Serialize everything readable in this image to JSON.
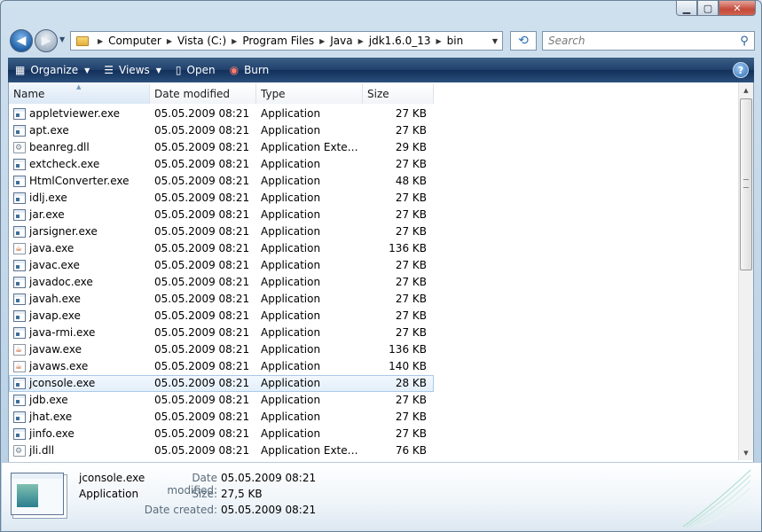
{
  "navigation": {
    "breadcrumbs": [
      "Computer",
      "Vista (C:)",
      "Program Files",
      "Java",
      "jdk1.6.0_13",
      "bin"
    ],
    "search_placeholder": "Search"
  },
  "toolbar": {
    "organize": "Organize",
    "views": "Views",
    "open": "Open",
    "burn": "Burn"
  },
  "columns": {
    "name": "Name",
    "date": "Date modified",
    "type": "Type",
    "size": "Size"
  },
  "files": [
    {
      "name": "appletviewer.exe",
      "date": "05.05.2009 08:21",
      "type": "Application",
      "size": "27 KB",
      "icon": "app"
    },
    {
      "name": "apt.exe",
      "date": "05.05.2009 08:21",
      "type": "Application",
      "size": "27 KB",
      "icon": "app"
    },
    {
      "name": "beanreg.dll",
      "date": "05.05.2009 08:21",
      "type": "Application Extens...",
      "size": "29 KB",
      "icon": "dll"
    },
    {
      "name": "extcheck.exe",
      "date": "05.05.2009 08:21",
      "type": "Application",
      "size": "27 KB",
      "icon": "app"
    },
    {
      "name": "HtmlConverter.exe",
      "date": "05.05.2009 08:21",
      "type": "Application",
      "size": "48 KB",
      "icon": "app"
    },
    {
      "name": "idlj.exe",
      "date": "05.05.2009 08:21",
      "type": "Application",
      "size": "27 KB",
      "icon": "app"
    },
    {
      "name": "jar.exe",
      "date": "05.05.2009 08:21",
      "type": "Application",
      "size": "27 KB",
      "icon": "app"
    },
    {
      "name": "jarsigner.exe",
      "date": "05.05.2009 08:21",
      "type": "Application",
      "size": "27 KB",
      "icon": "app"
    },
    {
      "name": "java.exe",
      "date": "05.05.2009 08:21",
      "type": "Application",
      "size": "136 KB",
      "icon": "java"
    },
    {
      "name": "javac.exe",
      "date": "05.05.2009 08:21",
      "type": "Application",
      "size": "27 KB",
      "icon": "app"
    },
    {
      "name": "javadoc.exe",
      "date": "05.05.2009 08:21",
      "type": "Application",
      "size": "27 KB",
      "icon": "app"
    },
    {
      "name": "javah.exe",
      "date": "05.05.2009 08:21",
      "type": "Application",
      "size": "27 KB",
      "icon": "app"
    },
    {
      "name": "javap.exe",
      "date": "05.05.2009 08:21",
      "type": "Application",
      "size": "27 KB",
      "icon": "app"
    },
    {
      "name": "java-rmi.exe",
      "date": "05.05.2009 08:21",
      "type": "Application",
      "size": "27 KB",
      "icon": "app"
    },
    {
      "name": "javaw.exe",
      "date": "05.05.2009 08:21",
      "type": "Application",
      "size": "136 KB",
      "icon": "java"
    },
    {
      "name": "javaws.exe",
      "date": "05.05.2009 08:21",
      "type": "Application",
      "size": "140 KB",
      "icon": "java"
    },
    {
      "name": "jconsole.exe",
      "date": "05.05.2009 08:21",
      "type": "Application",
      "size": "28 KB",
      "icon": "app",
      "selected": true
    },
    {
      "name": "jdb.exe",
      "date": "05.05.2009 08:21",
      "type": "Application",
      "size": "27 KB",
      "icon": "app"
    },
    {
      "name": "jhat.exe",
      "date": "05.05.2009 08:21",
      "type": "Application",
      "size": "27 KB",
      "icon": "app"
    },
    {
      "name": "jinfo.exe",
      "date": "05.05.2009 08:21",
      "type": "Application",
      "size": "27 KB",
      "icon": "app"
    },
    {
      "name": "jli.dll",
      "date": "05.05.2009 08:21",
      "type": "Application Extens...",
      "size": "76 KB",
      "icon": "dll"
    }
  ],
  "details": {
    "name": "jconsole.exe",
    "type": "Application",
    "date_modified_label": "Date modified:",
    "date_modified": "05.05.2009 08:21",
    "size_label": "Size:",
    "size": "27,5 KB",
    "date_created_label": "Date created:",
    "date_created": "05.05.2009 08:21"
  }
}
